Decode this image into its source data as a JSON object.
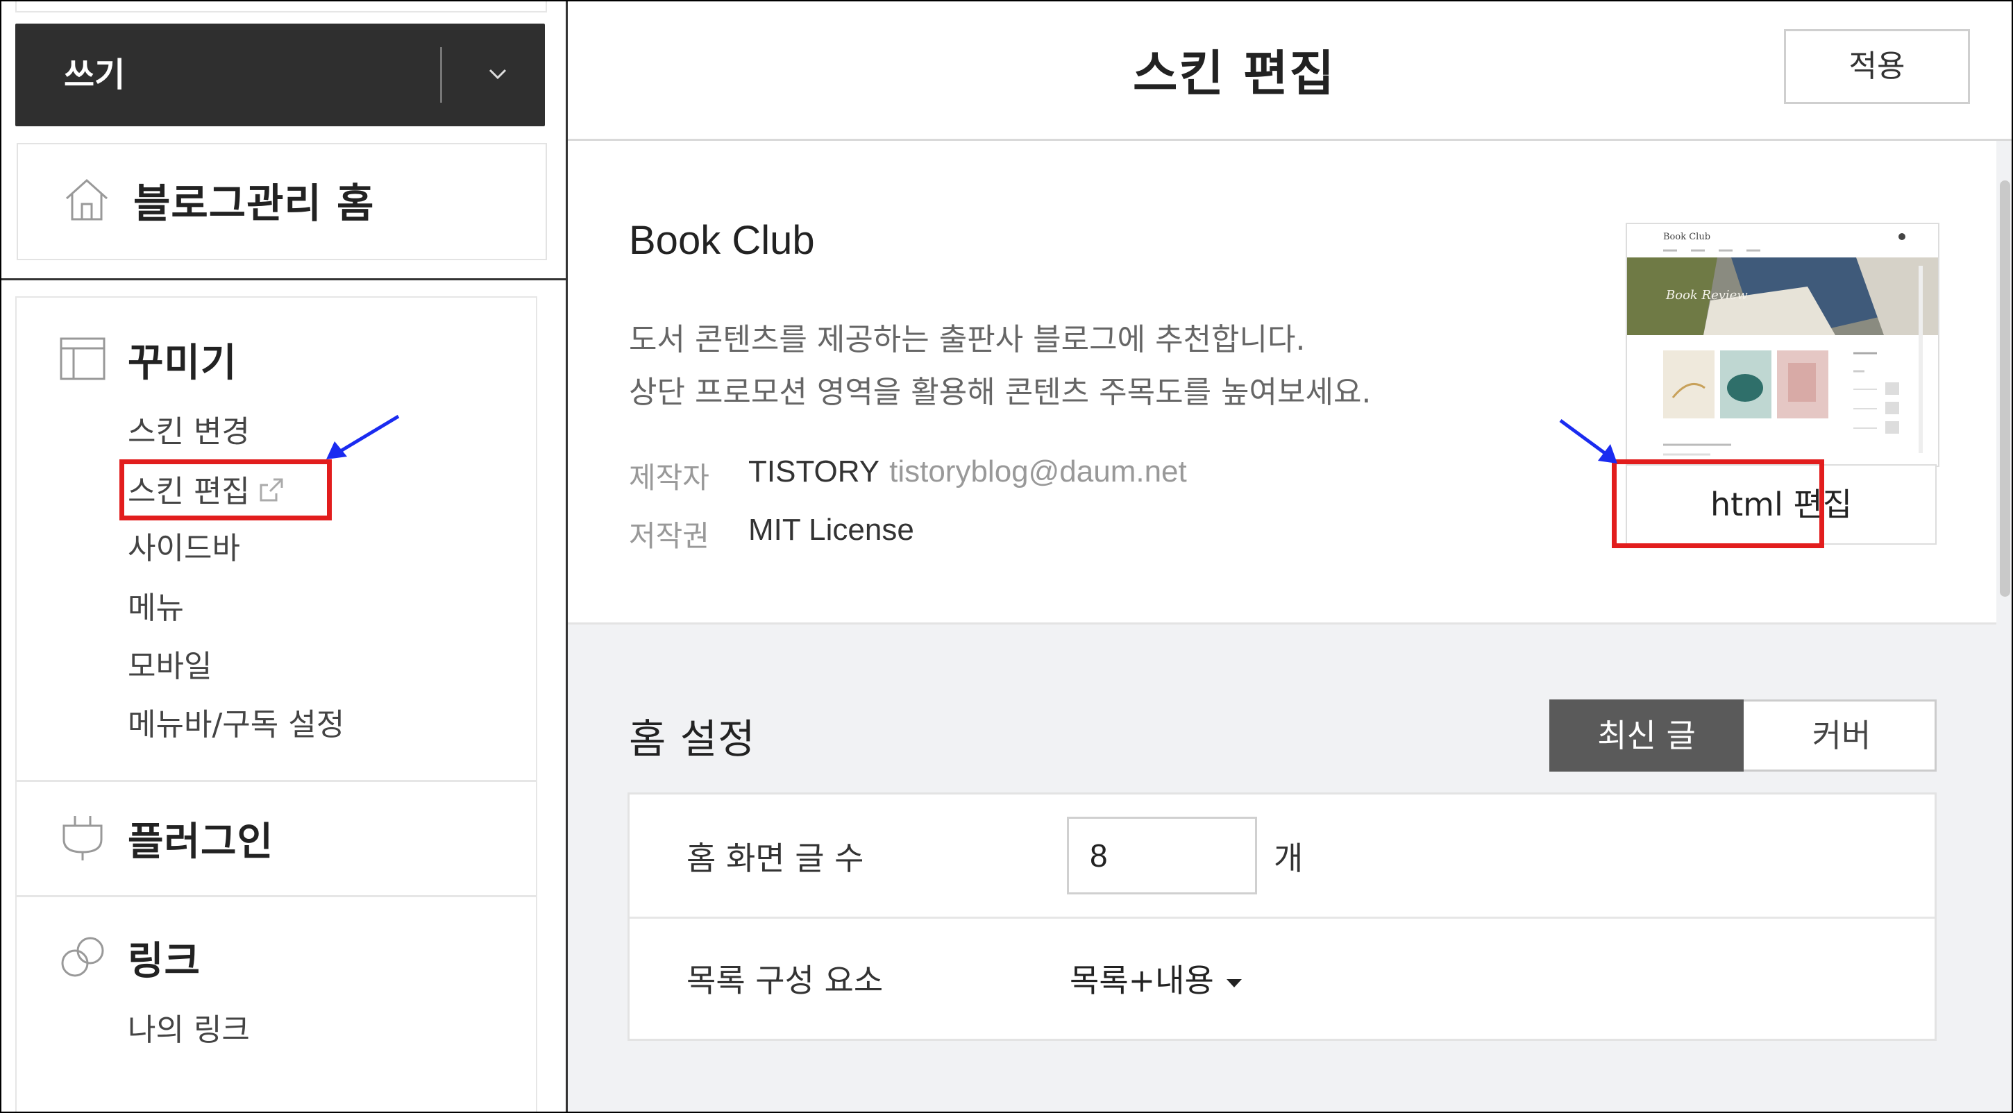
{
  "sidebar": {
    "write_label": "쓰기",
    "home_label": "블로그관리 홈",
    "sections": {
      "decorate": {
        "title": "꾸미기",
        "items": [
          "스킨 변경",
          "스킨 편집",
          "사이드바",
          "메뉴",
          "모바일",
          "메뉴바/구독 설정"
        ]
      },
      "plugin": {
        "title": "플러그인"
      },
      "link": {
        "title": "링크",
        "items": [
          "나의 링크"
        ]
      }
    }
  },
  "header": {
    "title": "스킨 편집",
    "apply_label": "적용"
  },
  "skin": {
    "name": "Book Club",
    "description_1": "도서 콘텐츠를 제공하는 출판사 블로그에 추천합니다.",
    "description_2": "상단 프로모션 영역을 활용해 콘텐츠 주목도를 높여보세요.",
    "author_label": "제작자",
    "author": "TISTORY",
    "author_email": "tistoryblog@daum.net",
    "copyright_label": "저작권",
    "copyright": "MIT License",
    "html_edit_label": "html 편집",
    "thumbnail": {
      "brand": "Book Club",
      "banner": "Book Review"
    }
  },
  "home_settings": {
    "title": "홈 설정",
    "toggle": {
      "active": "최신 글",
      "inactive": "커버"
    },
    "post_count_label": "홈 화면 글 수",
    "post_count_value": "8",
    "post_count_unit": "개",
    "list_component_label": "목록 구성 요소",
    "list_component_value": "목록+내용"
  },
  "colors": {
    "highlight": "#e21d1d",
    "annotation_arrow": "#1a2bf0",
    "write_bar": "#2f2f2f",
    "toggle_active": "#5a5a5a"
  }
}
